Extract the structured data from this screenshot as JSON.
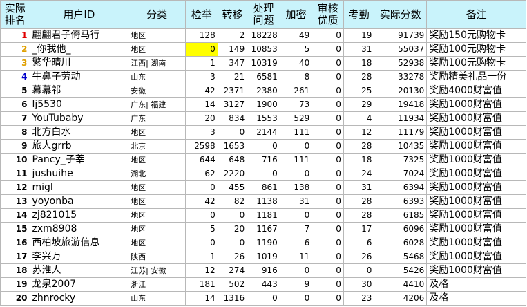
{
  "headers": [
    "实际\n排名",
    "用户ID",
    "分类",
    "检举",
    "转移",
    "处理\n问题",
    "加密",
    "审核\n优质",
    "考勤",
    "实际分数",
    "备注"
  ],
  "rank_colors": {
    "1": "#e00000",
    "2": "#e0a000",
    "3": "#e0a000",
    "4": "#0000cc"
  },
  "highlight_color": "#ffff00",
  "rows": [
    {
      "rank": "1",
      "user": "翩翩君子倚马行",
      "cat": "地区",
      "report": "128",
      "transfer": "2",
      "handle": "18228",
      "encrypt": "49",
      "quality": "0",
      "attend": "19",
      "score": "91739",
      "note": "奖励150元购物卡"
    },
    {
      "rank": "2",
      "user": "_你我他_",
      "cat": "地区",
      "report": "0",
      "transfer": "149",
      "handle": "10853",
      "encrypt": "5",
      "quality": "0",
      "attend": "31",
      "score": "55037",
      "note": "奖励100元购物卡",
      "hl": true
    },
    {
      "rank": "3",
      "user": "繁华晴川",
      "cat": "江西| 湖南",
      "report": "1",
      "transfer": "347",
      "handle": "10319",
      "encrypt": "40",
      "quality": "0",
      "attend": "18",
      "score": "52938",
      "note": "奖励100元购物卡"
    },
    {
      "rank": "4",
      "user": "牛鼻子劳动",
      "cat": "山东",
      "report": "3",
      "transfer": "21",
      "handle": "6581",
      "encrypt": "8",
      "quality": "0",
      "attend": "28",
      "score": "33278",
      "note": "奖励精美礼品一份"
    },
    {
      "rank": "5",
      "user": "幕幕祁",
      "cat": "安徽",
      "report": "42",
      "transfer": "2371",
      "handle": "2380",
      "encrypt": "261",
      "quality": "0",
      "attend": "25",
      "score": "20130",
      "note": "奖励4000财富值"
    },
    {
      "rank": "6",
      "user": "lj5530",
      "cat": "广东| 福建",
      "report": "14",
      "transfer": "3127",
      "handle": "1900",
      "encrypt": "73",
      "quality": "0",
      "attend": "29",
      "score": "19418",
      "note": "奖励1000财富值"
    },
    {
      "rank": "7",
      "user": "YouTubaby",
      "cat": "广东",
      "report": "20",
      "transfer": "834",
      "handle": "1553",
      "encrypt": "529",
      "quality": "0",
      "attend": "4",
      "score": "11934",
      "note": "奖励1000财富值"
    },
    {
      "rank": "8",
      "user": "北方白水",
      "cat": "地区",
      "report": "3",
      "transfer": "0",
      "handle": "2144",
      "encrypt": "111",
      "quality": "0",
      "attend": "12",
      "score": "11179",
      "note": "奖励1000财富值"
    },
    {
      "rank": "9",
      "user": "旅人grrb",
      "cat": "北京",
      "report": "2598",
      "transfer": "1653",
      "handle": "0",
      "encrypt": "0",
      "quality": "0",
      "attend": "28",
      "score": "10435",
      "note": "奖励1000财富值"
    },
    {
      "rank": "10",
      "user": "Pancy_子莘",
      "cat": "地区",
      "report": "644",
      "transfer": "648",
      "handle": "716",
      "encrypt": "111",
      "quality": "0",
      "attend": "18",
      "score": "7325",
      "note": "奖励1000财富值"
    },
    {
      "rank": "11",
      "user": "jushuihe",
      "cat": "湖北",
      "report": "62",
      "transfer": "2220",
      "handle": "0",
      "encrypt": "0",
      "quality": "0",
      "attend": "24",
      "score": "7024",
      "note": "奖励1000财富值"
    },
    {
      "rank": "12",
      "user": "migl",
      "cat": "地区",
      "report": "0",
      "transfer": "455",
      "handle": "861",
      "encrypt": "138",
      "quality": "0",
      "attend": "31",
      "score": "6394",
      "note": "奖励1000财富值"
    },
    {
      "rank": "13",
      "user": "yoyonba",
      "cat": "地区",
      "report": "42",
      "transfer": "82",
      "handle": "1138",
      "encrypt": "31",
      "quality": "0",
      "attend": "28",
      "score": "6393",
      "note": "奖励1000财富值"
    },
    {
      "rank": "14",
      "user": "zj821015",
      "cat": "地区",
      "report": "0",
      "transfer": "0",
      "handle": "1181",
      "encrypt": "0",
      "quality": "0",
      "attend": "28",
      "score": "6185",
      "note": "奖励1000财富值"
    },
    {
      "rank": "15",
      "user": "zxm8908",
      "cat": "地区",
      "report": "5",
      "transfer": "20",
      "handle": "1167",
      "encrypt": "7",
      "quality": "0",
      "attend": "17",
      "score": "6096",
      "note": "奖励1000财富值"
    },
    {
      "rank": "16",
      "user": "西柏坡旅游信息",
      "cat": "地区",
      "report": "0",
      "transfer": "0",
      "handle": "1190",
      "encrypt": "6",
      "quality": "0",
      "attend": "6",
      "score": "6028",
      "note": "奖励1000财富值"
    },
    {
      "rank": "17",
      "user": "李兴万",
      "cat": "陕西",
      "report": "1",
      "transfer": "26",
      "handle": "1019",
      "encrypt": "11",
      "quality": "0",
      "attend": "26",
      "score": "5468",
      "note": "奖励1000财富值"
    },
    {
      "rank": "18",
      "user": "苏淮人",
      "cat": "江苏| 安徽",
      "report": "12",
      "transfer": "274",
      "handle": "916",
      "encrypt": "0",
      "quality": "0",
      "attend": "0",
      "score": "5426",
      "note": "奖励1000财富值"
    },
    {
      "rank": "19",
      "user": "龙泉2007",
      "cat": "浙江",
      "report": "181",
      "transfer": "502",
      "handle": "443",
      "encrypt": "9",
      "quality": "0",
      "attend": "30",
      "score": "4410",
      "note": "及格"
    },
    {
      "rank": "20",
      "user": "zhnrocky",
      "cat": "山东",
      "report": "14",
      "transfer": "1316",
      "handle": "0",
      "encrypt": "0",
      "quality": "0",
      "attend": "23",
      "score": "4206",
      "note": "及格"
    }
  ]
}
